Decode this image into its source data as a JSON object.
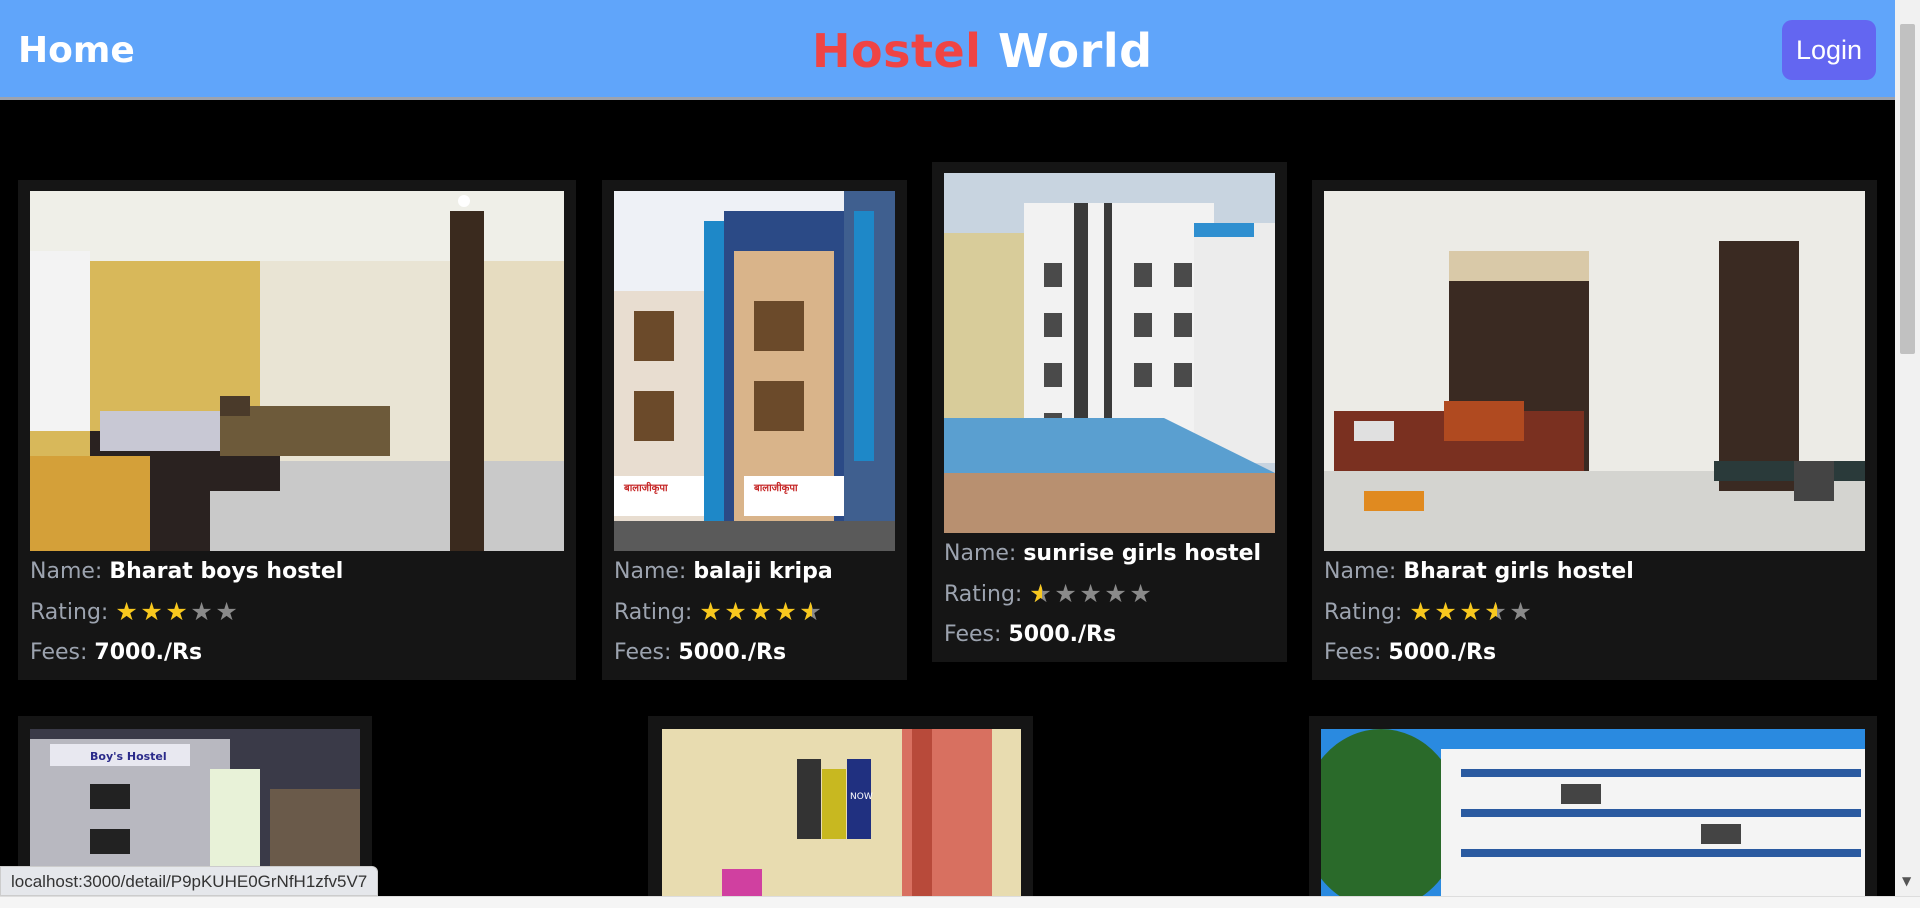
{
  "nav": {
    "home_label": "Home",
    "brand_part1": "Hostel",
    "brand_part2": "World",
    "login_label": "Login"
  },
  "labels": {
    "name": "Name:",
    "rating": "Rating:",
    "fees": "Fees:"
  },
  "hostels": [
    {
      "name": "Bharat boys hostel",
      "rating": 3,
      "fees": "7000./Rs"
    },
    {
      "name": "balaji kripa",
      "rating": 4.5,
      "fees": "5000./Rs"
    },
    {
      "name": "sunrise girls hostel",
      "rating": 0.5,
      "fees": "5000./Rs"
    },
    {
      "name": "Bharat girls hostel",
      "rating": 3.5,
      "fees": "5000./Rs"
    }
  ],
  "photo_signs": {
    "boys_hostel": "Boy's Hostel",
    "balaji_1": "बालाजीकृपा",
    "balaji_2": "बालाजीकृपा",
    "poster": "NOW"
  },
  "status_bar_url": "localhost:3000/detail/P9pKUHE0GrNfH1zfv5V7",
  "colors": {
    "navbar": "#60a5fa",
    "brand_red": "#ef4444",
    "login_button": "#6366f1",
    "star_filled": "#f8c81e",
    "star_empty": "#8a8a8a"
  }
}
